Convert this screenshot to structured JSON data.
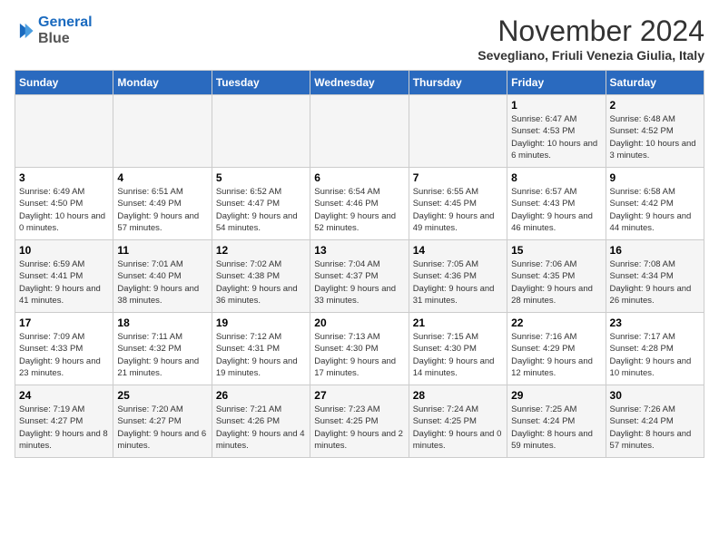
{
  "header": {
    "logo_line1": "General",
    "logo_line2": "Blue",
    "month_title": "November 2024",
    "location": "Sevegliano, Friuli Venezia Giulia, Italy"
  },
  "days_of_week": [
    "Sunday",
    "Monday",
    "Tuesday",
    "Wednesday",
    "Thursday",
    "Friday",
    "Saturday"
  ],
  "weeks": [
    [
      {
        "day": "",
        "info": ""
      },
      {
        "day": "",
        "info": ""
      },
      {
        "day": "",
        "info": ""
      },
      {
        "day": "",
        "info": ""
      },
      {
        "day": "",
        "info": ""
      },
      {
        "day": "1",
        "info": "Sunrise: 6:47 AM\nSunset: 4:53 PM\nDaylight: 10 hours and 6 minutes."
      },
      {
        "day": "2",
        "info": "Sunrise: 6:48 AM\nSunset: 4:52 PM\nDaylight: 10 hours and 3 minutes."
      }
    ],
    [
      {
        "day": "3",
        "info": "Sunrise: 6:49 AM\nSunset: 4:50 PM\nDaylight: 10 hours and 0 minutes."
      },
      {
        "day": "4",
        "info": "Sunrise: 6:51 AM\nSunset: 4:49 PM\nDaylight: 9 hours and 57 minutes."
      },
      {
        "day": "5",
        "info": "Sunrise: 6:52 AM\nSunset: 4:47 PM\nDaylight: 9 hours and 54 minutes."
      },
      {
        "day": "6",
        "info": "Sunrise: 6:54 AM\nSunset: 4:46 PM\nDaylight: 9 hours and 52 minutes."
      },
      {
        "day": "7",
        "info": "Sunrise: 6:55 AM\nSunset: 4:45 PM\nDaylight: 9 hours and 49 minutes."
      },
      {
        "day": "8",
        "info": "Sunrise: 6:57 AM\nSunset: 4:43 PM\nDaylight: 9 hours and 46 minutes."
      },
      {
        "day": "9",
        "info": "Sunrise: 6:58 AM\nSunset: 4:42 PM\nDaylight: 9 hours and 44 minutes."
      }
    ],
    [
      {
        "day": "10",
        "info": "Sunrise: 6:59 AM\nSunset: 4:41 PM\nDaylight: 9 hours and 41 minutes."
      },
      {
        "day": "11",
        "info": "Sunrise: 7:01 AM\nSunset: 4:40 PM\nDaylight: 9 hours and 38 minutes."
      },
      {
        "day": "12",
        "info": "Sunrise: 7:02 AM\nSunset: 4:38 PM\nDaylight: 9 hours and 36 minutes."
      },
      {
        "day": "13",
        "info": "Sunrise: 7:04 AM\nSunset: 4:37 PM\nDaylight: 9 hours and 33 minutes."
      },
      {
        "day": "14",
        "info": "Sunrise: 7:05 AM\nSunset: 4:36 PM\nDaylight: 9 hours and 31 minutes."
      },
      {
        "day": "15",
        "info": "Sunrise: 7:06 AM\nSunset: 4:35 PM\nDaylight: 9 hours and 28 minutes."
      },
      {
        "day": "16",
        "info": "Sunrise: 7:08 AM\nSunset: 4:34 PM\nDaylight: 9 hours and 26 minutes."
      }
    ],
    [
      {
        "day": "17",
        "info": "Sunrise: 7:09 AM\nSunset: 4:33 PM\nDaylight: 9 hours and 23 minutes."
      },
      {
        "day": "18",
        "info": "Sunrise: 7:11 AM\nSunset: 4:32 PM\nDaylight: 9 hours and 21 minutes."
      },
      {
        "day": "19",
        "info": "Sunrise: 7:12 AM\nSunset: 4:31 PM\nDaylight: 9 hours and 19 minutes."
      },
      {
        "day": "20",
        "info": "Sunrise: 7:13 AM\nSunset: 4:30 PM\nDaylight: 9 hours and 17 minutes."
      },
      {
        "day": "21",
        "info": "Sunrise: 7:15 AM\nSunset: 4:30 PM\nDaylight: 9 hours and 14 minutes."
      },
      {
        "day": "22",
        "info": "Sunrise: 7:16 AM\nSunset: 4:29 PM\nDaylight: 9 hours and 12 minutes."
      },
      {
        "day": "23",
        "info": "Sunrise: 7:17 AM\nSunset: 4:28 PM\nDaylight: 9 hours and 10 minutes."
      }
    ],
    [
      {
        "day": "24",
        "info": "Sunrise: 7:19 AM\nSunset: 4:27 PM\nDaylight: 9 hours and 8 minutes."
      },
      {
        "day": "25",
        "info": "Sunrise: 7:20 AM\nSunset: 4:27 PM\nDaylight: 9 hours and 6 minutes."
      },
      {
        "day": "26",
        "info": "Sunrise: 7:21 AM\nSunset: 4:26 PM\nDaylight: 9 hours and 4 minutes."
      },
      {
        "day": "27",
        "info": "Sunrise: 7:23 AM\nSunset: 4:25 PM\nDaylight: 9 hours and 2 minutes."
      },
      {
        "day": "28",
        "info": "Sunrise: 7:24 AM\nSunset: 4:25 PM\nDaylight: 9 hours and 0 minutes."
      },
      {
        "day": "29",
        "info": "Sunrise: 7:25 AM\nSunset: 4:24 PM\nDaylight: 8 hours and 59 minutes."
      },
      {
        "day": "30",
        "info": "Sunrise: 7:26 AM\nSunset: 4:24 PM\nDaylight: 8 hours and 57 minutes."
      }
    ]
  ]
}
